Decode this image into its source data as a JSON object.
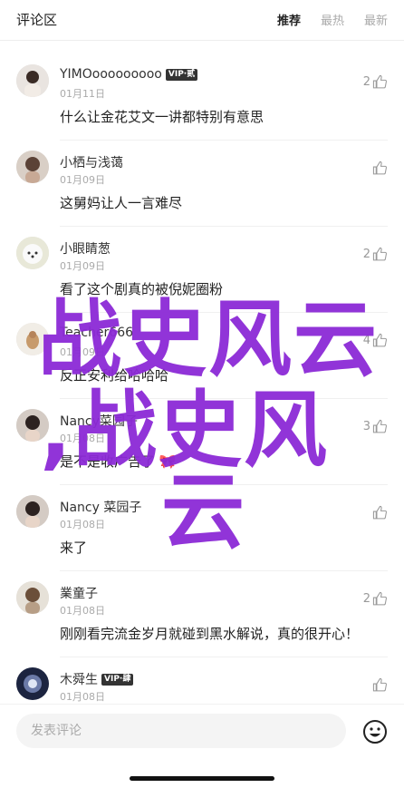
{
  "header": {
    "title": "评论区",
    "tabs": [
      "推荐",
      "最热",
      "最新"
    ],
    "active_tab": "推荐"
  },
  "comments": [
    {
      "name": "YIMOooooooooo",
      "badge": "VIP·贰",
      "date": "01月11日",
      "text": "什么让金花艾文一讲都特别有意思",
      "likes": "2"
    },
    {
      "name": "小栖与浅蔼",
      "badge": "",
      "date": "01月09日",
      "text": "这舅妈让人一言难尽",
      "likes": ""
    },
    {
      "name": "小眼睛葱",
      "badge": "",
      "date": "01月09日",
      "text": "看了这个剧真的被倪妮圈粉",
      "likes": "2"
    },
    {
      "name": "Teacher666",
      "badge": "",
      "date": "01月09日",
      "text": "反正安利给哈哈哈",
      "likes": "4"
    },
    {
      "name": "Nancy菜园子",
      "badge": "",
      "date": "01月08日",
      "text": "是不是收广告了",
      "likes": "3"
    },
    {
      "name": "Nancy 菜园子",
      "badge": "",
      "date": "01月08日",
      "text": "来了",
      "likes": ""
    },
    {
      "name": "業童子",
      "badge": "",
      "date": "01月08日",
      "text": "刚刚看完流金岁月就碰到黑水解说，真的很开心！",
      "likes": "2"
    },
    {
      "name": "木舜生",
      "badge": "VIP·肆",
      "date": "01月08日",
      "text": "",
      "likes": ""
    }
  ],
  "watermark": {
    "line1": "战史风云",
    "line2": ",战史风",
    "line3": "云"
  },
  "footer": {
    "input_placeholder": "发表评论"
  },
  "colors": {
    "watermark": "#8c2ad6",
    "badge_bg": "#333333"
  }
}
